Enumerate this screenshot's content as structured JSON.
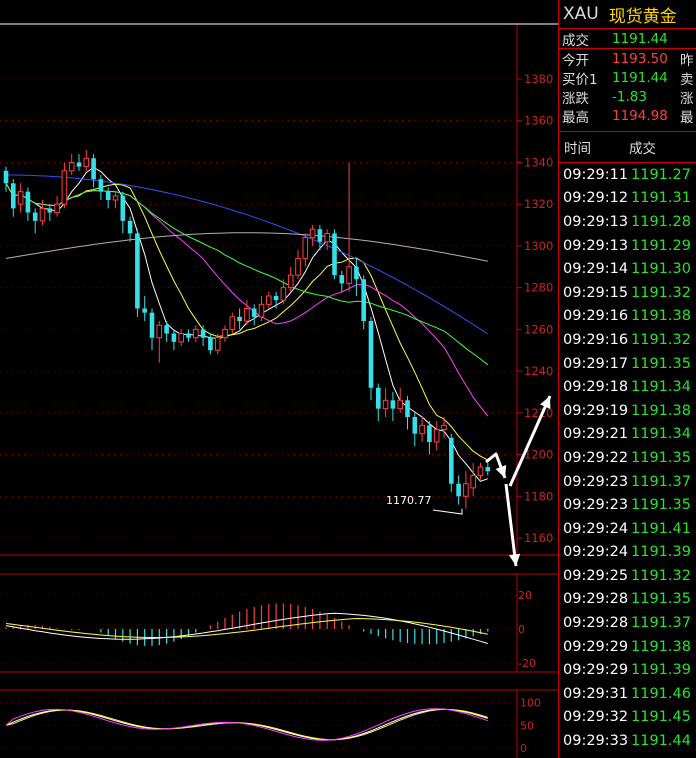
{
  "chart": {
    "price_ticks": [
      "1380",
      "1360",
      "1340",
      "1320",
      "1300",
      "1280",
      "1260",
      "1240",
      "1220",
      "1200",
      "1180",
      "1160"
    ],
    "macd_ticks": [
      "20",
      "0",
      "-20"
    ],
    "kdj_ticks": [
      "100",
      "50",
      "0"
    ],
    "low_label": "1170.77",
    "colors": {
      "up": "#ff4040",
      "down": "#35e0e8",
      "ma5": "#ffffff",
      "ma10": "#ffff40",
      "ma20": "#ff40ff",
      "ma30": "#40ff40",
      "ma60": "#3050ff",
      "ma120": "#b0b0b0",
      "axis": "#c00000"
    }
  },
  "quote": {
    "symbol": "XAU",
    "name": "现货黄金",
    "rows": [
      {
        "label": "成交",
        "value": "1191.44",
        "color": "#27e427",
        "extra": ""
      },
      {
        "label": "今开",
        "value": "1193.50",
        "color": "#ff4040",
        "extra": "昨"
      },
      {
        "label": "买价1",
        "value": "1191.44",
        "color": "#27e427",
        "extra": "卖"
      },
      {
        "label": "涨跌",
        "value": "-1.83",
        "color": "#27e427",
        "extra": "涨"
      },
      {
        "label": "最高",
        "value": "1194.98",
        "color": "#ff4040",
        "extra": "最"
      }
    ],
    "tick_headers": {
      "time": "时间",
      "price": "成交"
    },
    "ticks": [
      {
        "time": "09:29:11",
        "price": "1191.27"
      },
      {
        "time": "09:29:12",
        "price": "1191.31"
      },
      {
        "time": "09:29:13",
        "price": "1191.28"
      },
      {
        "time": "09:29:13",
        "price": "1191.29"
      },
      {
        "time": "09:29:14",
        "price": "1191.30"
      },
      {
        "time": "09:29:15",
        "price": "1191.32"
      },
      {
        "time": "09:29:16",
        "price": "1191.38"
      },
      {
        "time": "09:29:16",
        "price": "1191.32"
      },
      {
        "time": "09:29:17",
        "price": "1191.35"
      },
      {
        "time": "09:29:18",
        "price": "1191.34"
      },
      {
        "time": "09:29:19",
        "price": "1191.38"
      },
      {
        "time": "09:29:21",
        "price": "1191.34"
      },
      {
        "time": "09:29:22",
        "price": "1191.35"
      },
      {
        "time": "09:29:23",
        "price": "1191.37"
      },
      {
        "time": "09:29:23",
        "price": "1191.35"
      },
      {
        "time": "09:29:24",
        "price": "1191.41"
      },
      {
        "time": "09:29:24",
        "price": "1191.39"
      },
      {
        "time": "09:29:25",
        "price": "1191.32"
      },
      {
        "time": "09:29:28",
        "price": "1191.35"
      },
      {
        "time": "09:29:28",
        "price": "1191.37"
      },
      {
        "time": "09:29:29",
        "price": "1191.38"
      },
      {
        "time": "09:29:29",
        "price": "1191.39"
      },
      {
        "time": "09:29:31",
        "price": "1191.46"
      },
      {
        "time": "09:29:32",
        "price": "1191.45"
      },
      {
        "time": "09:29:33",
        "price": "1191.44"
      }
    ]
  }
}
